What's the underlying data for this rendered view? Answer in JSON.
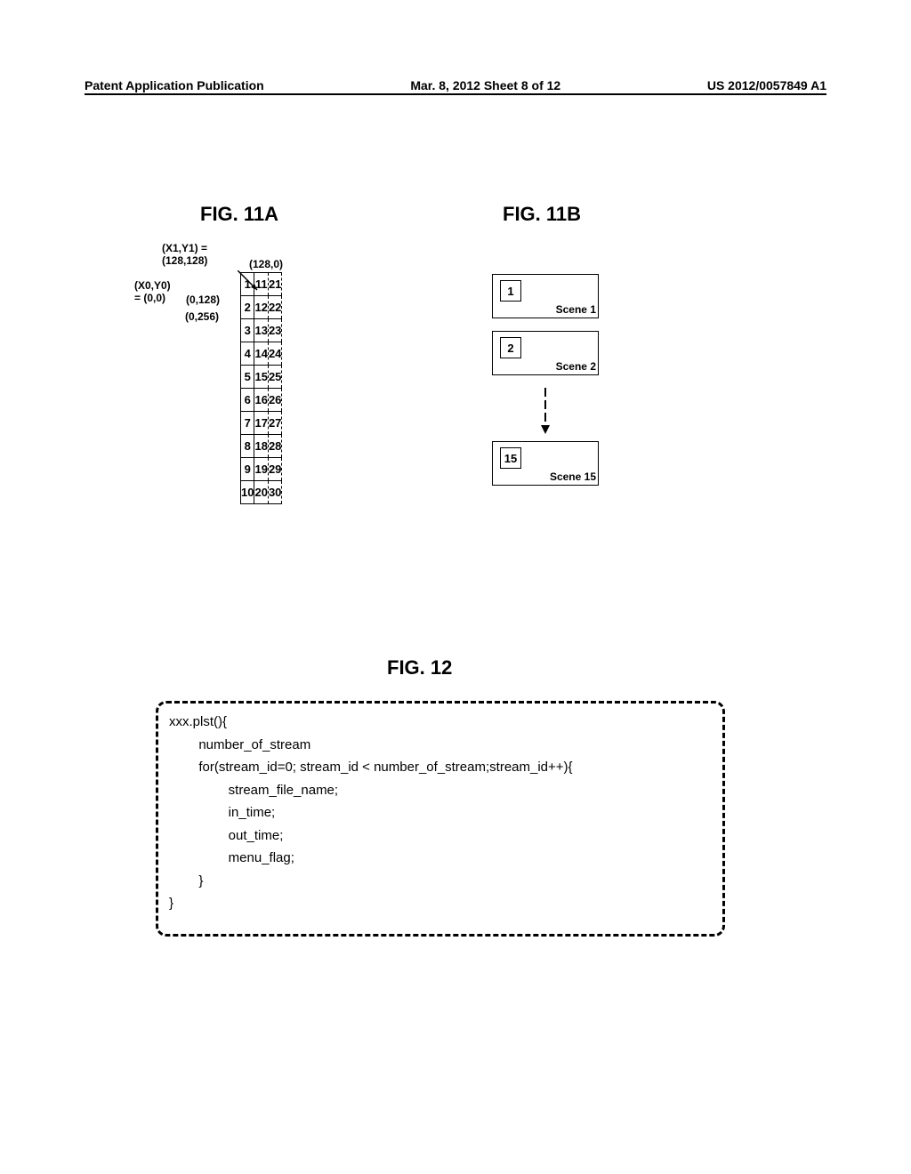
{
  "header": {
    "left": "Patent Application Publication",
    "center": "Mar. 8, 2012  Sheet 8 of 12",
    "right": "US 2012/0057849 A1"
  },
  "fig11a": {
    "title": "FIG. 11A",
    "labels": {
      "xy1": "(X1,Y1) = (128,128)",
      "p128_0": "(128,0)",
      "xy0": "(X0,Y0) = (0,0)",
      "p0_128": "(0,128)",
      "p0_256": "(0,256)"
    },
    "grid": [
      [
        "1",
        "11",
        "21"
      ],
      [
        "2",
        "12",
        "22"
      ],
      [
        "3",
        "13",
        "23"
      ],
      [
        "4",
        "14",
        "24"
      ],
      [
        "5",
        "15",
        "25"
      ],
      [
        "6",
        "16",
        "26"
      ],
      [
        "7",
        "17",
        "27"
      ],
      [
        "8",
        "18",
        "28"
      ],
      [
        "9",
        "19",
        "29"
      ],
      [
        "10",
        "20",
        "30"
      ]
    ]
  },
  "fig11b": {
    "title": "FIG. 11B",
    "scenes": [
      {
        "num": "1",
        "label": "Scene 1"
      },
      {
        "num": "2",
        "label": "Scene 2"
      },
      {
        "num": "15",
        "label": "Scene 15"
      }
    ]
  },
  "fig12": {
    "title": "FIG. 12",
    "code": {
      "l0": "xxx.plst(){",
      "l1": "        number_of_stream",
      "l2": "        for(stream_id=0; stream_id < number_of_stream;stream_id++){",
      "l3": "                stream_file_name;",
      "l4": "                in_time;",
      "l5": "                out_time;",
      "l6": "                menu_flag;",
      "l7": "        }",
      "l8": "}"
    }
  }
}
